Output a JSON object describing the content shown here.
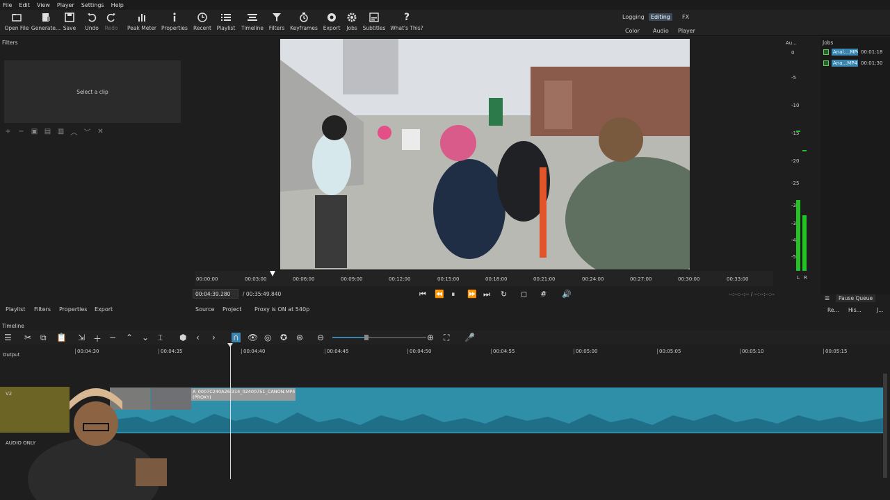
{
  "menu": [
    "File",
    "Edit",
    "View",
    "Player",
    "Settings",
    "Help"
  ],
  "toolbar": [
    {
      "label": "Open File",
      "icon": "open-file-icon"
    },
    {
      "label": "Generate...",
      "icon": "generate-icon"
    },
    {
      "label": "Save",
      "icon": "save-icon"
    },
    {
      "label": "Undo",
      "icon": "undo-icon"
    },
    {
      "label": "Redo",
      "icon": "redo-icon"
    },
    {
      "label": "Peak Meter",
      "icon": "peak-meter-icon"
    },
    {
      "label": "Properties",
      "icon": "properties-icon"
    },
    {
      "label": "Recent",
      "icon": "recent-icon"
    },
    {
      "label": "Playlist",
      "icon": "playlist-icon"
    },
    {
      "label": "Timeline",
      "icon": "timeline-icon"
    },
    {
      "label": "Filters",
      "icon": "filters-icon"
    },
    {
      "label": "Keyframes",
      "icon": "keyframes-icon"
    },
    {
      "label": "Export",
      "icon": "export-icon"
    },
    {
      "label": "Jobs",
      "icon": "jobs-icon"
    },
    {
      "label": "Subtitles",
      "icon": "subtitles-icon"
    },
    {
      "label": "What's This?",
      "icon": "help-icon"
    }
  ],
  "layouts": {
    "row1": [
      "Logging",
      "Editing",
      "FX"
    ],
    "row2": [
      "Color",
      "Audio",
      "Player"
    ],
    "selected": "Editing"
  },
  "filters": {
    "title": "Filters",
    "empty_text": "Select a clip"
  },
  "player": {
    "ticks": [
      "00:00:00",
      "00:03:00",
      "00:06:00",
      "00:09:00",
      "00:12:00",
      "00:15:00",
      "00:18:00",
      "00:21:00",
      "00:24:00",
      "00:27:00",
      "00:30:00",
      "00:33:00"
    ],
    "position": "00:04:39.280",
    "total": "/ 00:35:49.840",
    "in_out": "--:--:--:-- / --:--:--:--",
    "source_tab": "Source",
    "project_tab": "Project",
    "proxy_label": "Proxy is ON at 540p"
  },
  "left_tabs": [
    "Playlist",
    "Filters",
    "Properties",
    "Export"
  ],
  "meter": {
    "title": "Au...",
    "scale": [
      "0",
      "-5",
      "-10",
      "-15",
      "-20",
      "-25",
      "-30",
      "-35",
      "-40",
      "-50"
    ],
    "channels": [
      "L",
      "R"
    ]
  },
  "jobs": {
    "title": "Jobs",
    "items": [
      {
        "name": "Anal....MP4",
        "time": "00:01:18"
      },
      {
        "name": "Ana...MP4",
        "time": "00:01:30"
      }
    ],
    "pause_label": "Pause Queue",
    "re_label": "Re...",
    "his_label": "His...",
    "j_label": "J..."
  },
  "timeline": {
    "title": "Timeline",
    "ruler": [
      "00:04:30",
      "00:04:35",
      "00:04:40",
      "00:04:45",
      "00:04:50",
      "00:04:55",
      "00:05:00",
      "00:05:05",
      "00:05:10",
      "00:05:15"
    ],
    "tracks": {
      "output": "Output",
      "v2": "V2",
      "audio": "AUDIO ONLY"
    },
    "clip_label_1": "A_0007C240A26I314_02400751_CANON.MP4",
    "clip_label_2": "(PROXY)"
  },
  "colors": {
    "accent": "#3a85b0",
    "clip": "#2f8fa8",
    "v2_header": "#6b6424",
    "meter": "#22c322"
  }
}
